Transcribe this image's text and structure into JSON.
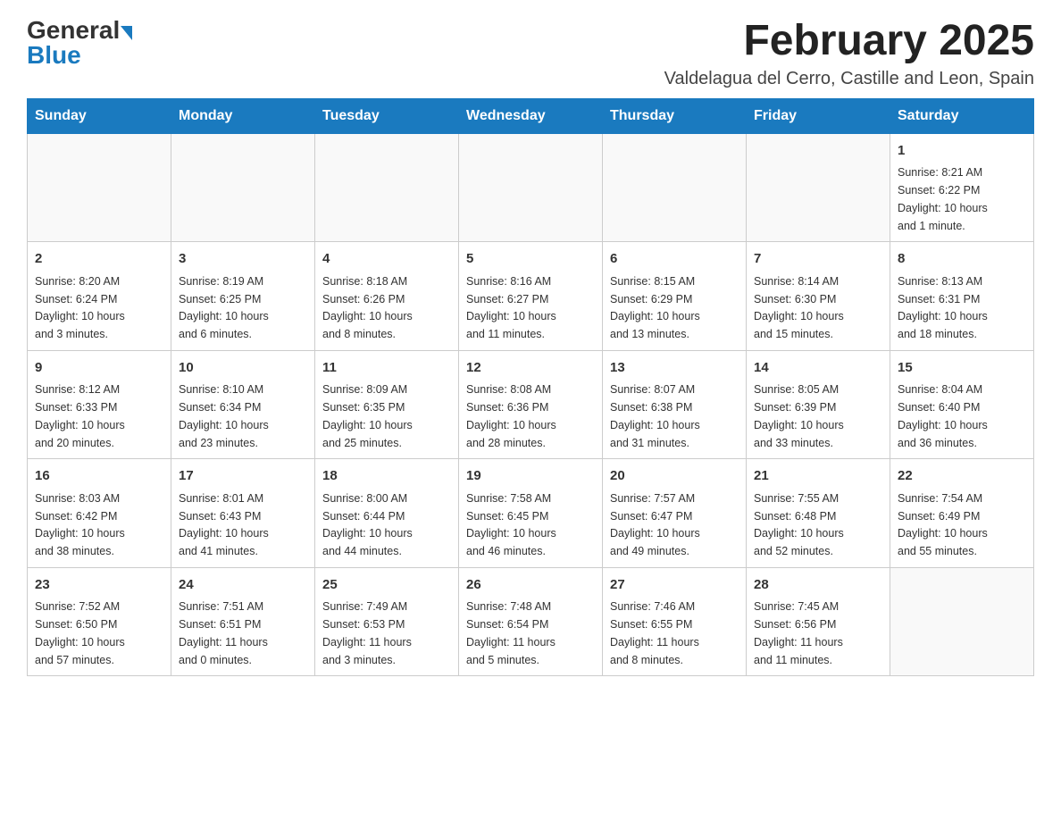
{
  "logo": {
    "general": "General",
    "blue": "Blue"
  },
  "title": "February 2025",
  "subtitle": "Valdelagua del Cerro, Castille and Leon, Spain",
  "days_of_week": [
    "Sunday",
    "Monday",
    "Tuesday",
    "Wednesday",
    "Thursday",
    "Friday",
    "Saturday"
  ],
  "weeks": [
    [
      {
        "day": "",
        "info": ""
      },
      {
        "day": "",
        "info": ""
      },
      {
        "day": "",
        "info": ""
      },
      {
        "day": "",
        "info": ""
      },
      {
        "day": "",
        "info": ""
      },
      {
        "day": "",
        "info": ""
      },
      {
        "day": "1",
        "info": "Sunrise: 8:21 AM\nSunset: 6:22 PM\nDaylight: 10 hours\nand 1 minute."
      }
    ],
    [
      {
        "day": "2",
        "info": "Sunrise: 8:20 AM\nSunset: 6:24 PM\nDaylight: 10 hours\nand 3 minutes."
      },
      {
        "day": "3",
        "info": "Sunrise: 8:19 AM\nSunset: 6:25 PM\nDaylight: 10 hours\nand 6 minutes."
      },
      {
        "day": "4",
        "info": "Sunrise: 8:18 AM\nSunset: 6:26 PM\nDaylight: 10 hours\nand 8 minutes."
      },
      {
        "day": "5",
        "info": "Sunrise: 8:16 AM\nSunset: 6:27 PM\nDaylight: 10 hours\nand 11 minutes."
      },
      {
        "day": "6",
        "info": "Sunrise: 8:15 AM\nSunset: 6:29 PM\nDaylight: 10 hours\nand 13 minutes."
      },
      {
        "day": "7",
        "info": "Sunrise: 8:14 AM\nSunset: 6:30 PM\nDaylight: 10 hours\nand 15 minutes."
      },
      {
        "day": "8",
        "info": "Sunrise: 8:13 AM\nSunset: 6:31 PM\nDaylight: 10 hours\nand 18 minutes."
      }
    ],
    [
      {
        "day": "9",
        "info": "Sunrise: 8:12 AM\nSunset: 6:33 PM\nDaylight: 10 hours\nand 20 minutes."
      },
      {
        "day": "10",
        "info": "Sunrise: 8:10 AM\nSunset: 6:34 PM\nDaylight: 10 hours\nand 23 minutes."
      },
      {
        "day": "11",
        "info": "Sunrise: 8:09 AM\nSunset: 6:35 PM\nDaylight: 10 hours\nand 25 minutes."
      },
      {
        "day": "12",
        "info": "Sunrise: 8:08 AM\nSunset: 6:36 PM\nDaylight: 10 hours\nand 28 minutes."
      },
      {
        "day": "13",
        "info": "Sunrise: 8:07 AM\nSunset: 6:38 PM\nDaylight: 10 hours\nand 31 minutes."
      },
      {
        "day": "14",
        "info": "Sunrise: 8:05 AM\nSunset: 6:39 PM\nDaylight: 10 hours\nand 33 minutes."
      },
      {
        "day": "15",
        "info": "Sunrise: 8:04 AM\nSunset: 6:40 PM\nDaylight: 10 hours\nand 36 minutes."
      }
    ],
    [
      {
        "day": "16",
        "info": "Sunrise: 8:03 AM\nSunset: 6:42 PM\nDaylight: 10 hours\nand 38 minutes."
      },
      {
        "day": "17",
        "info": "Sunrise: 8:01 AM\nSunset: 6:43 PM\nDaylight: 10 hours\nand 41 minutes."
      },
      {
        "day": "18",
        "info": "Sunrise: 8:00 AM\nSunset: 6:44 PM\nDaylight: 10 hours\nand 44 minutes."
      },
      {
        "day": "19",
        "info": "Sunrise: 7:58 AM\nSunset: 6:45 PM\nDaylight: 10 hours\nand 46 minutes."
      },
      {
        "day": "20",
        "info": "Sunrise: 7:57 AM\nSunset: 6:47 PM\nDaylight: 10 hours\nand 49 minutes."
      },
      {
        "day": "21",
        "info": "Sunrise: 7:55 AM\nSunset: 6:48 PM\nDaylight: 10 hours\nand 52 minutes."
      },
      {
        "day": "22",
        "info": "Sunrise: 7:54 AM\nSunset: 6:49 PM\nDaylight: 10 hours\nand 55 minutes."
      }
    ],
    [
      {
        "day": "23",
        "info": "Sunrise: 7:52 AM\nSunset: 6:50 PM\nDaylight: 10 hours\nand 57 minutes."
      },
      {
        "day": "24",
        "info": "Sunrise: 7:51 AM\nSunset: 6:51 PM\nDaylight: 11 hours\nand 0 minutes."
      },
      {
        "day": "25",
        "info": "Sunrise: 7:49 AM\nSunset: 6:53 PM\nDaylight: 11 hours\nand 3 minutes."
      },
      {
        "day": "26",
        "info": "Sunrise: 7:48 AM\nSunset: 6:54 PM\nDaylight: 11 hours\nand 5 minutes."
      },
      {
        "day": "27",
        "info": "Sunrise: 7:46 AM\nSunset: 6:55 PM\nDaylight: 11 hours\nand 8 minutes."
      },
      {
        "day": "28",
        "info": "Sunrise: 7:45 AM\nSunset: 6:56 PM\nDaylight: 11 hours\nand 11 minutes."
      },
      {
        "day": "",
        "info": ""
      }
    ]
  ]
}
